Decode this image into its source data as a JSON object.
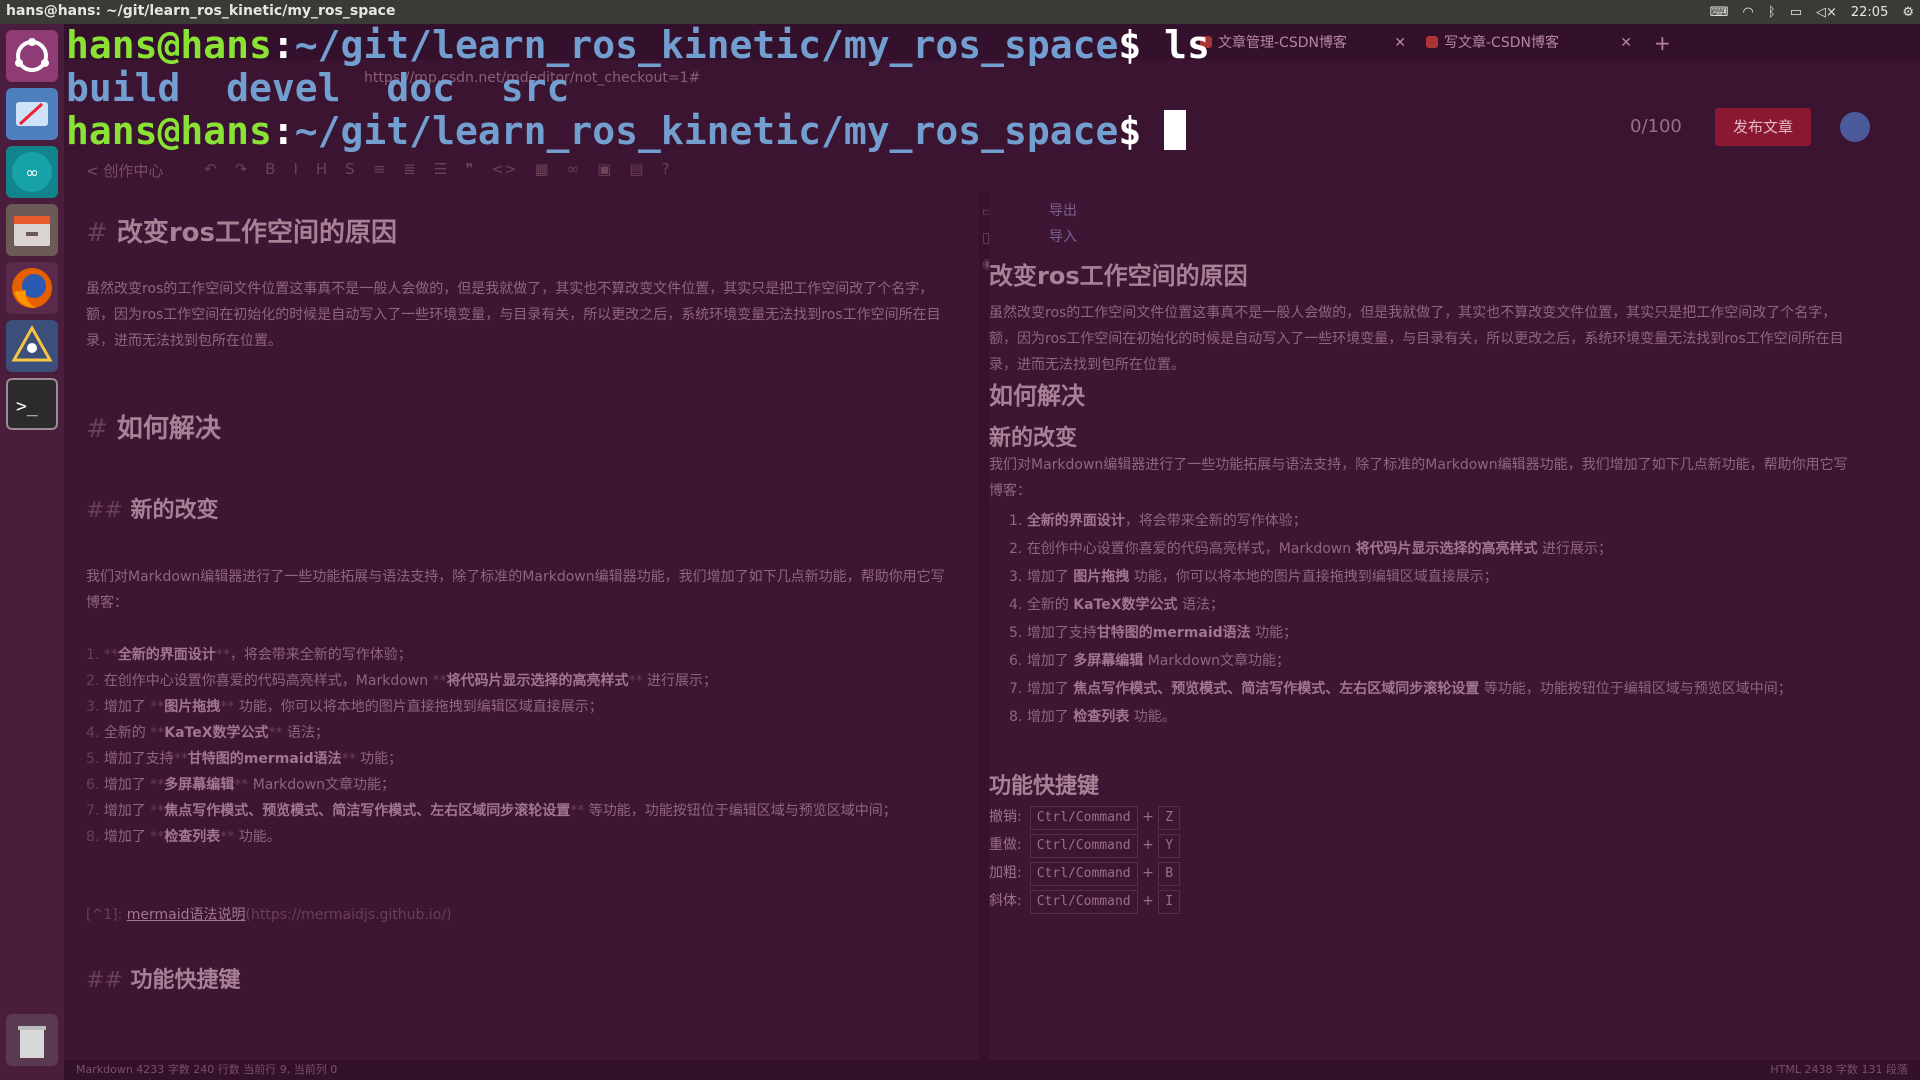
{
  "topbar": {
    "window_title": "hans@hans: ~/git/learn_ros_kinetic/my_ros_space",
    "time": "22:05"
  },
  "launcher": {
    "items": [
      "ubuntu-dash",
      "screenshot-tool",
      "arduino",
      "files",
      "firefox",
      "ros-app",
      "terminal",
      "trash"
    ]
  },
  "terminal": {
    "prompt_user": "hans@hans",
    "prompt_sep": ":",
    "prompt_path": "~/git/learn_ros_kinetic/my_ros_space",
    "prompt_symbol": "$",
    "command": " ls",
    "ls_output": [
      "build",
      "devel",
      "doc",
      "src"
    ]
  },
  "browser": {
    "tabs": [
      {
        "label": "文章管理-CSDN博客"
      },
      {
        "label": "写文章-CSDN博客"
      }
    ],
    "url": "https://mp.csdn.net/mdeditor/not_checkout=1#",
    "counter": "0/100",
    "publish_label": "发布文章",
    "back_label": "创作中心",
    "export_label": "导出",
    "import_label": "导入"
  },
  "editor": {
    "h1": "改变ros工作空间的原因",
    "para1": "虽然改变ros的工作空间文件位置这事真不是一般人会做的，但是我就做了，其实也不算改变文件位置，其实只是把工作空间改了个名字，额，因为ros工作空间在初始化的时候是自动写入了一些环境变量，与目录有关，所以更改之后，系统环境变量无法找到ros工作空间所在目录，进而无法找到包所在位置。",
    "h1b": "如何解决",
    "h2": "新的改变",
    "para2": "我们对Markdown编辑器进行了一些功能拓展与语法支持，除了标准的Markdown编辑器功能，我们增加了如下几点新功能，帮助你用它写博客：",
    "items": [
      {
        "num": "1.",
        "pre": "",
        "bold": "全新的界面设计",
        "post": "，将会带来全新的写作体验；"
      },
      {
        "num": "2.",
        "pre": "在创作中心设置你喜爱的代码高亮样式，Markdown ",
        "bold": "将代码片显示选择的高亮样式",
        "post": " 进行展示；"
      },
      {
        "num": "3.",
        "pre": "增加了 ",
        "bold": "图片拖拽",
        "post": " 功能，你可以将本地的图片直接拖拽到编辑区域直接展示；"
      },
      {
        "num": "4.",
        "pre": "全新的 ",
        "bold": "KaTeX数学公式",
        "post": " 语法；"
      },
      {
        "num": "5.",
        "pre": "增加了支持",
        "bold": "甘特图的mermaid语法",
        "post": " 功能；"
      },
      {
        "num": "6.",
        "pre": "增加了 ",
        "bold": "多屏幕编辑",
        "post": " Markdown文章功能；"
      },
      {
        "num": "7.",
        "pre": "增加了 ",
        "bold": "焦点写作模式、预览模式、简洁写作模式、左右区域同步滚轮设置",
        "post": " 等功能，功能按钮位于编辑区域与预览区域中间；"
      },
      {
        "num": "8.",
        "pre": "增加了 ",
        "bold": "检查列表",
        "post": " 功能。"
      }
    ],
    "footnote_label": "mermaid语法说明",
    "footnote_url": "https://mermaidjs.github.io/",
    "h2b": "功能快捷键"
  },
  "preview": {
    "shortcuts": [
      {
        "label": "撤销:",
        "key": "Ctrl/Command",
        "plus": "+",
        "letter": "Z"
      },
      {
        "label": "重做:",
        "key": "Ctrl/Command",
        "plus": "+",
        "letter": "Y"
      },
      {
        "label": "加粗:",
        "key": "Ctrl/Command",
        "plus": "+",
        "letter": "B"
      },
      {
        "label": "斜体:",
        "key": "Ctrl/Command",
        "plus": "+",
        "letter": "I"
      }
    ]
  },
  "status": {
    "left": "Markdown  4233 字数  240 行数  当前行 9, 当前列 0",
    "right": "HTML  2438 字数  131 段落"
  },
  "colors": {
    "prompt_user": "#8ae234",
    "prompt_path": "#729fcf",
    "launcher_bg": "#4a1d3c",
    "terminal_bg": "#2c0a24"
  }
}
